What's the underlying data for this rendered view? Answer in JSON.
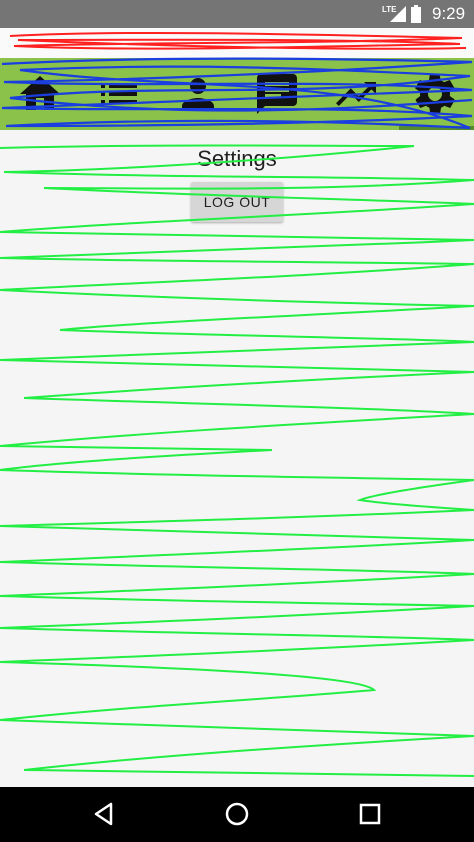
{
  "status_bar": {
    "network": "LTE",
    "time": "9:29"
  },
  "toolbar": {
    "tabs": [
      {
        "icon": "home-icon"
      },
      {
        "icon": "list-icon"
      },
      {
        "icon": "person-icon"
      },
      {
        "icon": "chat-icon"
      },
      {
        "icon": "trending-icon"
      },
      {
        "icon": "gear-icon",
        "selected": true
      }
    ],
    "accent_color": "#8bc34a"
  },
  "main": {
    "title": "Settings",
    "logout_label": "LOG OUT"
  },
  "nav_bar": {
    "buttons": [
      "back-icon",
      "home-circle-icon",
      "recents-icon"
    ]
  }
}
